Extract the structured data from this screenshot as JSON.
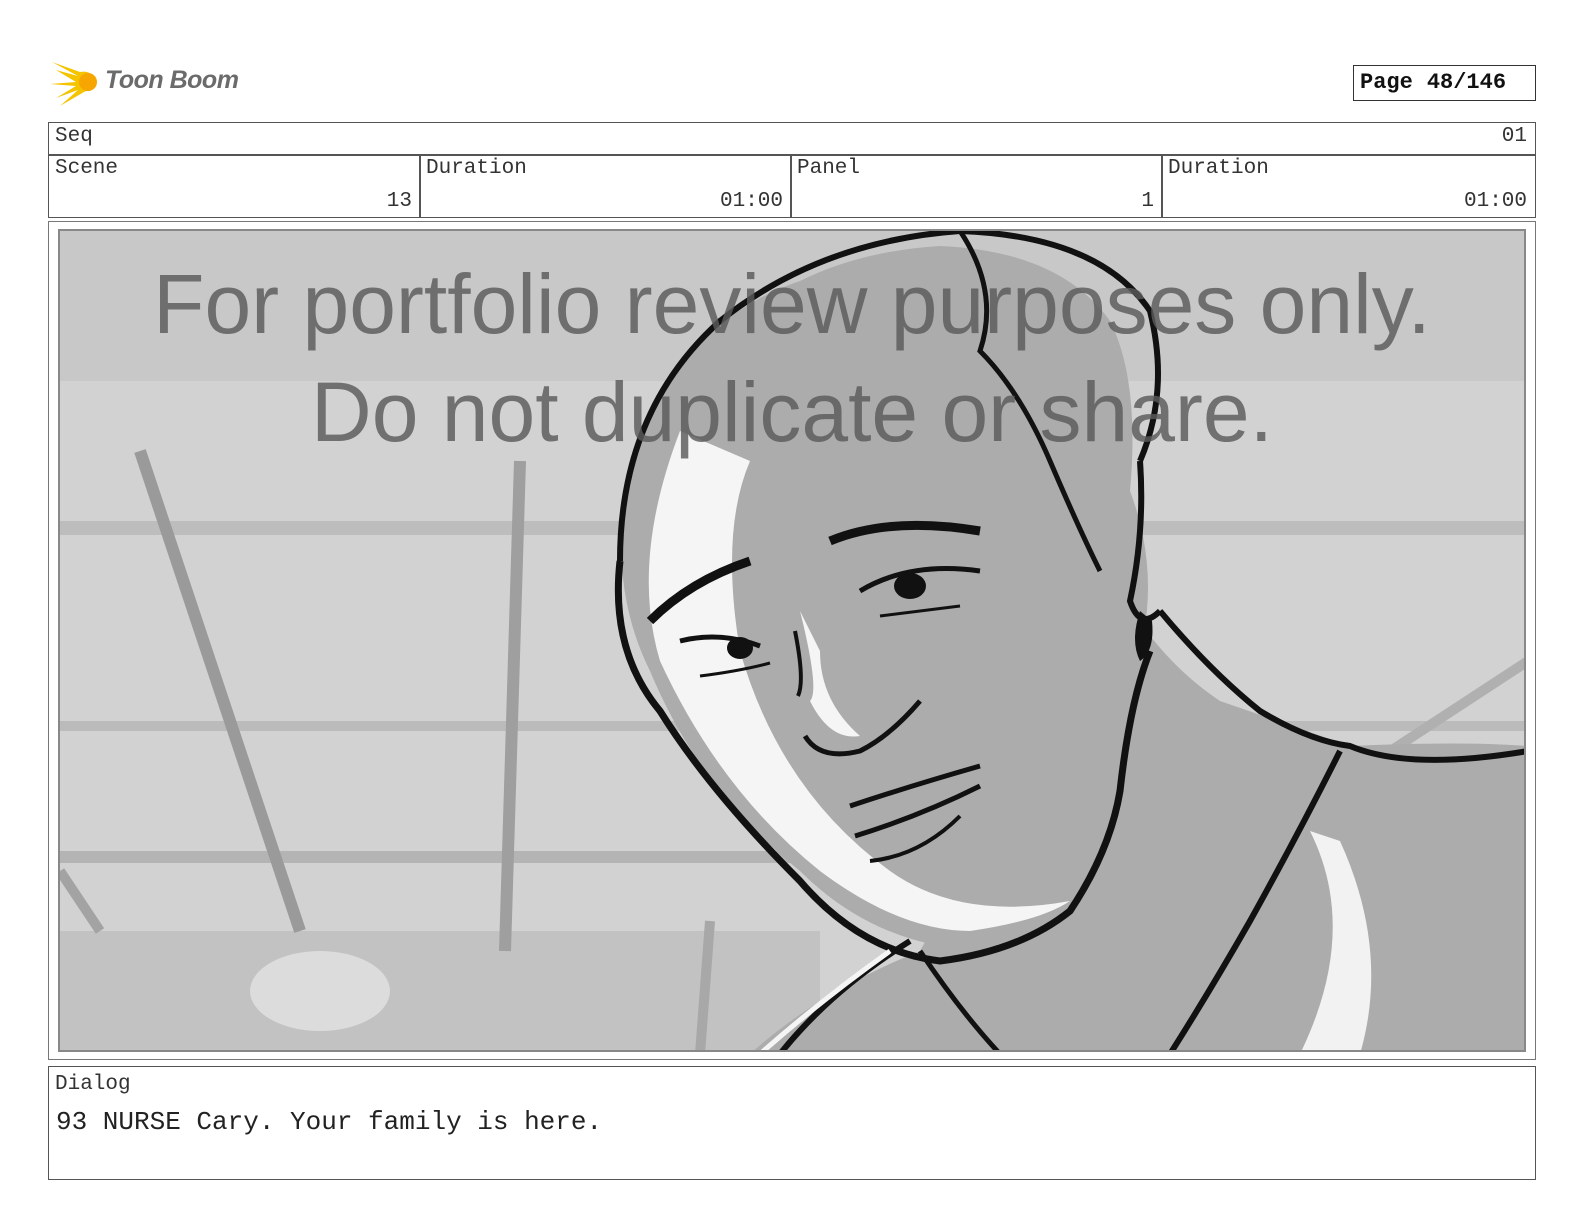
{
  "header": {
    "logo_text": "Toon Boom",
    "page_label": "Page",
    "page_number": "48/146"
  },
  "seq": {
    "label": "Seq",
    "value": "01"
  },
  "scene": {
    "label": "Scene",
    "value": "13"
  },
  "scene_duration": {
    "label": "Duration",
    "value": "01:00"
  },
  "panel": {
    "label": "Panel",
    "value": "1"
  },
  "panel_duration": {
    "label": "Duration",
    "value": "01:00"
  },
  "watermark": {
    "line1": "For portfolio review purposes only.",
    "line2": "Do not duplicate or share."
  },
  "dialog": {
    "label": "Dialog",
    "text": "93 NURSE Cary. Your family is here."
  },
  "colors": {
    "logo_yellow": "#f5c400",
    "sketch_gray": "#aeaeae",
    "background_gray": "#d2d2d2"
  }
}
